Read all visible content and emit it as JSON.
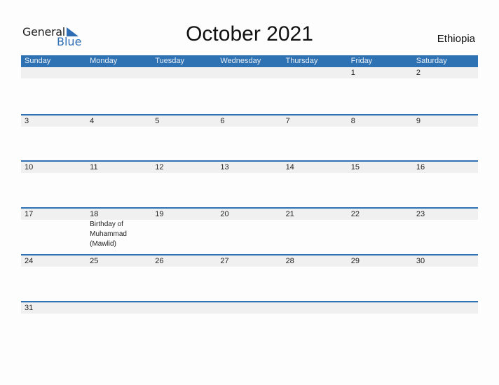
{
  "logo": {
    "line1": "General",
    "line2": "Blue"
  },
  "title": "October 2021",
  "country": "Ethiopia",
  "colors": {
    "accent": "#2e72b3",
    "band": "#f0f0f0"
  },
  "weekdays": [
    "Sunday",
    "Monday",
    "Tuesday",
    "Wednesday",
    "Thursday",
    "Friday",
    "Saturday"
  ],
  "weeks": [
    [
      {
        "d": ""
      },
      {
        "d": ""
      },
      {
        "d": ""
      },
      {
        "d": ""
      },
      {
        "d": ""
      },
      {
        "d": "1"
      },
      {
        "d": "2"
      }
    ],
    [
      {
        "d": "3"
      },
      {
        "d": "4"
      },
      {
        "d": "5"
      },
      {
        "d": "6"
      },
      {
        "d": "7"
      },
      {
        "d": "8"
      },
      {
        "d": "9"
      }
    ],
    [
      {
        "d": "10"
      },
      {
        "d": "11"
      },
      {
        "d": "12"
      },
      {
        "d": "13"
      },
      {
        "d": "14"
      },
      {
        "d": "15"
      },
      {
        "d": "16"
      }
    ],
    [
      {
        "d": "17"
      },
      {
        "d": "18",
        "event": "Birthday of Muhammad (Mawlid)"
      },
      {
        "d": "19"
      },
      {
        "d": "20"
      },
      {
        "d": "21"
      },
      {
        "d": "22"
      },
      {
        "d": "23"
      }
    ],
    [
      {
        "d": "24"
      },
      {
        "d": "25"
      },
      {
        "d": "26"
      },
      {
        "d": "27"
      },
      {
        "d": "28"
      },
      {
        "d": "29"
      },
      {
        "d": "30"
      }
    ],
    [
      {
        "d": "31"
      },
      {
        "d": ""
      },
      {
        "d": ""
      },
      {
        "d": ""
      },
      {
        "d": ""
      },
      {
        "d": ""
      },
      {
        "d": ""
      }
    ]
  ]
}
